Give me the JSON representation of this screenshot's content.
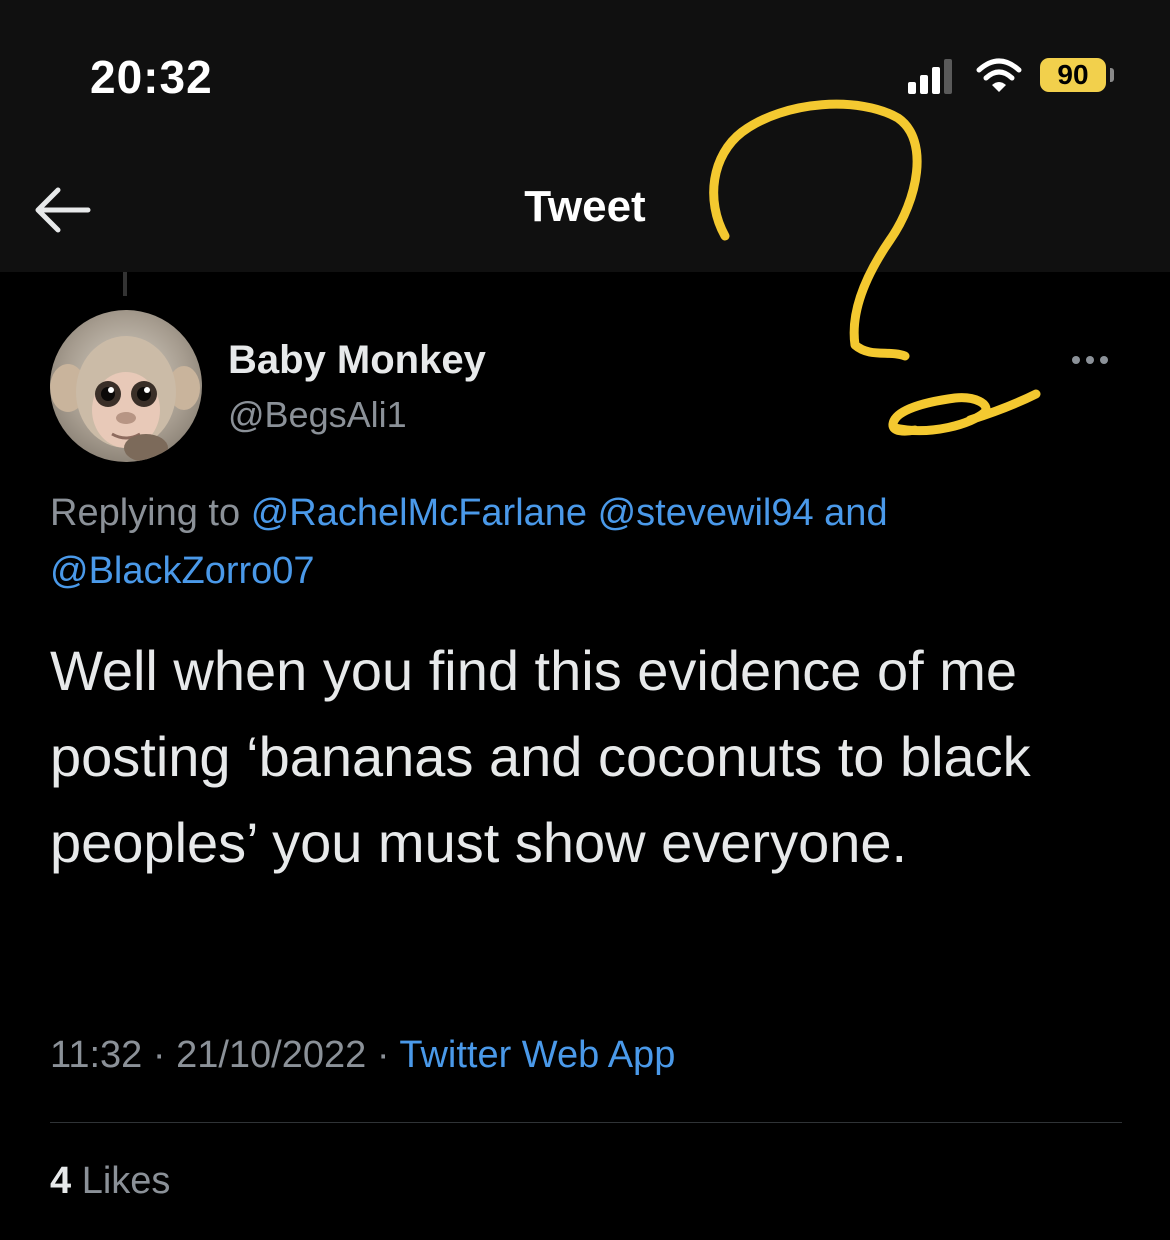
{
  "status_bar": {
    "time": "20:32",
    "battery": "90",
    "icons": [
      "signal-icon",
      "wifi-icon",
      "battery-icon"
    ]
  },
  "header": {
    "title": "Tweet",
    "back_icon": "arrow-left-icon"
  },
  "tweet": {
    "author": {
      "display_name": "Baby Monkey",
      "handle": "@BegsAli1",
      "avatar": "baby-monkey-photo"
    },
    "reply": {
      "prefix": "Replying to",
      "mentions": [
        "@RachelMcFarlane",
        "@stevewil94",
        "@BlackZorro07"
      ],
      "conjunction": "and"
    },
    "text": "Well when you find this evidence of me posting ‘bananas and coconuts to black peoples’ you must show everyone.",
    "time": "11:32",
    "separator": "·",
    "date": "21/10/2022",
    "source": "Twitter Web App",
    "likes_count": "4",
    "likes_label": "Likes",
    "more_icon": "more-horizontal-icon"
  },
  "colors": {
    "background": "#000000",
    "header_background": "#101010",
    "link": "#4a99e9",
    "muted": "#8b9198",
    "annotation": "#f4c930",
    "battery": "#f2d04c"
  }
}
